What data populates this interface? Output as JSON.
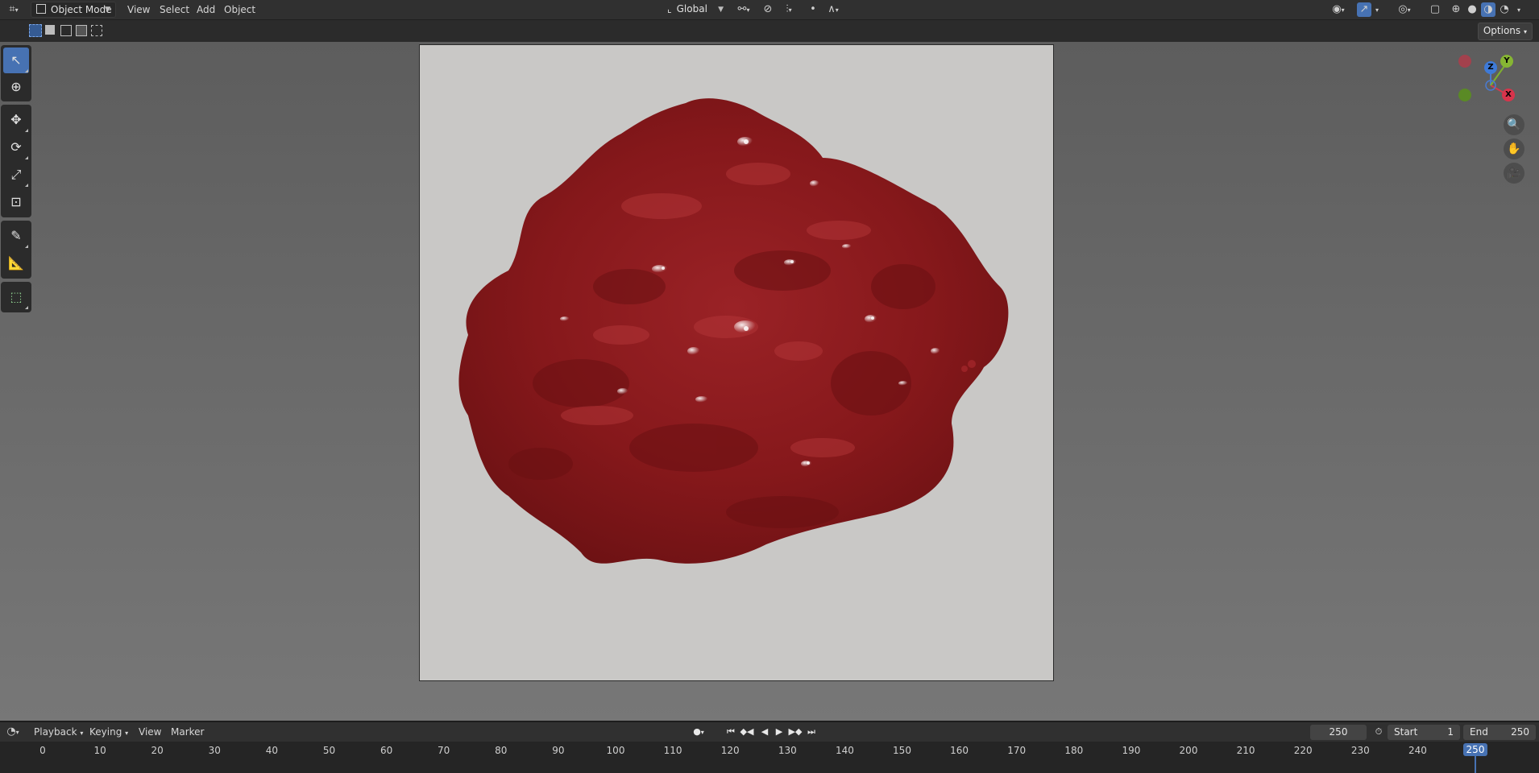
{
  "header": {
    "editor_type_icon": "editor-type-icon",
    "mode_dropdown": "Object Mode",
    "menus": [
      "View",
      "Select",
      "Add",
      "Object"
    ],
    "orientation_dropdown": "Global",
    "icons": [
      "transform-pivot-icon",
      "snap-icon",
      "proportional-edit-icon",
      "visibility-icon",
      "gizmo-icon",
      "overlay-icon",
      "xray-icon",
      "wireframe-shading-icon",
      "solid-shading-icon",
      "material-shading-icon",
      "rendered-shading-icon"
    ]
  },
  "viewport": {
    "options_label": "Options",
    "gizmo": {
      "x": "X",
      "y": "Y",
      "z": "Z"
    },
    "accent": "#4772b3",
    "blob_color": "#8b1a1c",
    "background_color": "#c9c8c6"
  },
  "toolbar": {
    "tools": [
      "select-box",
      "cursor",
      "move",
      "rotate",
      "scale",
      "transform",
      "annotate",
      "measure",
      "add-cube"
    ]
  },
  "timeline": {
    "menus": [
      "Playback",
      "Keying",
      "View",
      "Marker"
    ],
    "current_frame": "250",
    "start_label": "Start",
    "start_value": "1",
    "end_label": "End",
    "end_value": "250",
    "ruler_ticks": [
      "0",
      "10",
      "20",
      "30",
      "40",
      "50",
      "60",
      "70",
      "80",
      "90",
      "100",
      "110",
      "120",
      "130",
      "140",
      "150",
      "160",
      "170",
      "180",
      "190",
      "200",
      "210",
      "220",
      "230",
      "240"
    ],
    "playhead_frame": "250"
  }
}
